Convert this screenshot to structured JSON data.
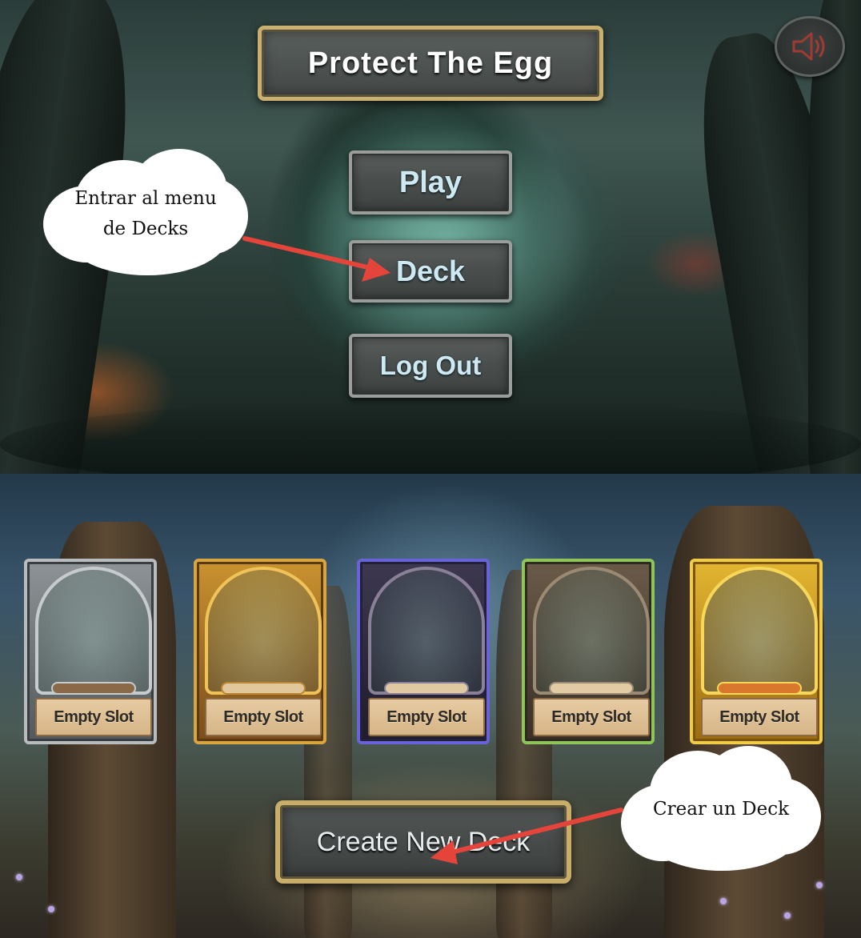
{
  "main_menu": {
    "title": "Protect The Egg",
    "buttons": {
      "play": "Play",
      "deck": "Deck",
      "log_out": "Log Out"
    },
    "sound_icon": "speaker-volume-icon"
  },
  "annotations": {
    "deck_hint_line1": "Entrar al menu",
    "deck_hint_line2": "de Decks",
    "create_hint": "Crear un Deck",
    "arrow_color": "#e5443a"
  },
  "deck_menu": {
    "slots": [
      {
        "label": "Empty Slot",
        "frame": "silver-skull",
        "accent": "#b8bcbf"
      },
      {
        "label": "Empty Slot",
        "frame": "gold-ember",
        "accent": "#d9a540"
      },
      {
        "label": "Empty Slot",
        "frame": "dark-violet",
        "accent": "#6a63d8"
      },
      {
        "label": "Empty Slot",
        "frame": "bronze-green",
        "accent": "#8fc45a"
      },
      {
        "label": "Empty Slot",
        "frame": "gold-skull",
        "accent": "#e2b531"
      }
    ],
    "create_button": "Create New Deck"
  },
  "colors": {
    "title_border": "#c9b070",
    "button_text": "#cfe9f3"
  }
}
